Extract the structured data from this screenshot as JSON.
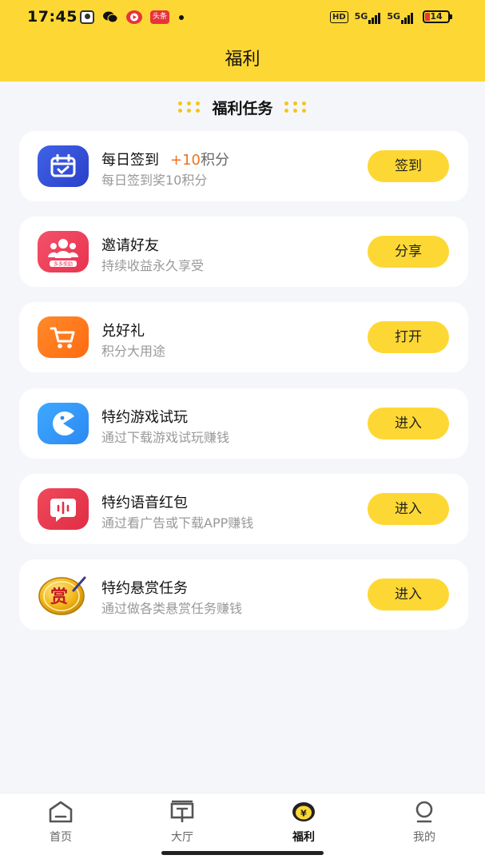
{
  "status_bar": {
    "time": "17:45",
    "app_badge": "头条",
    "hd_label": "HD",
    "network_1": "5G",
    "network_2": "5G",
    "battery": "14"
  },
  "header": {
    "title": "福利"
  },
  "section": {
    "title": "福利任务"
  },
  "tasks": [
    {
      "title": "每日签到",
      "points_value": "+10",
      "points_unit": "积分",
      "subtitle": "每日签到奖10积分",
      "button": "签到",
      "icon": "calendar-check-icon"
    },
    {
      "title": "邀请好友",
      "badge": "多多奖励",
      "subtitle": "持续收益永久享受",
      "button": "分享",
      "icon": "friends-icon"
    },
    {
      "title": "兑好礼",
      "subtitle": "积分大用途",
      "button": "打开",
      "icon": "shopping-cart-icon"
    },
    {
      "title": "特约游戏试玩",
      "subtitle": "通过下载游戏试玩赚钱",
      "button": "进入",
      "icon": "game-pacman-icon"
    },
    {
      "title": "特约语音红包",
      "subtitle": "通过看广告或下载APP赚钱",
      "button": "进入",
      "icon": "voice-bubble-icon"
    },
    {
      "title": "特约悬赏任务",
      "icon_text": "赏",
      "subtitle": "通过做各类悬赏任务赚钱",
      "button": "进入",
      "icon": "reward-coin-icon"
    }
  ],
  "nav": {
    "items": [
      {
        "label": "首页",
        "icon": "home-icon"
      },
      {
        "label": "大厅",
        "icon": "hall-icon"
      },
      {
        "label": "福利",
        "icon": "welfare-coin-icon",
        "active": true
      },
      {
        "label": "我的",
        "icon": "profile-icon"
      }
    ],
    "welfare_symbol": "¥"
  },
  "colors": {
    "accent": "#fdd835",
    "points": "#f0711f",
    "background": "#f5f6fa"
  }
}
